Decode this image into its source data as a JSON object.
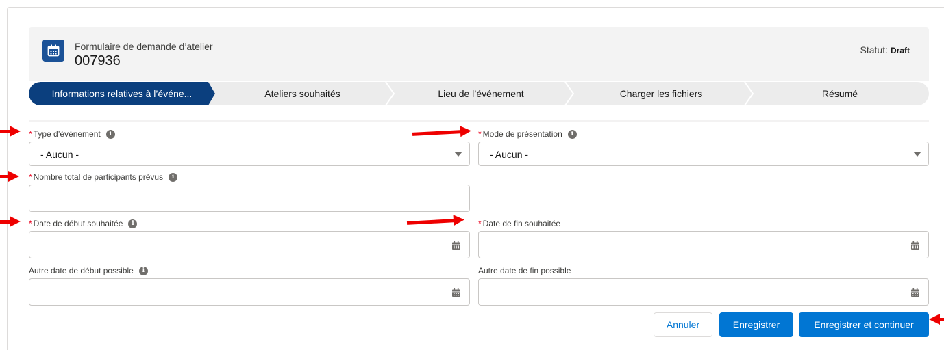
{
  "header": {
    "subtitle": "Formulaire de demande d’atelier",
    "title": "007936",
    "status_label": "Statut:",
    "status_value": "Draft",
    "icon": "calendar-icon",
    "color": "#1b5297"
  },
  "path": {
    "steps": [
      {
        "label": "Informations relatives à l’événe..."
      },
      {
        "label": "Ateliers souhaités"
      },
      {
        "label": "Lieu de l’événement"
      },
      {
        "label": "Charger les fichiers"
      },
      {
        "label": "Résumé"
      }
    ],
    "active_index": 0,
    "active_color": "#0b3f7e"
  },
  "form": {
    "required_marker": "*",
    "info_glyph": "i",
    "type_evenement": {
      "label": "Type d’événement",
      "value": "- Aucun -"
    },
    "mode_presentation": {
      "label": "Mode de présentation",
      "value": "- Aucun -"
    },
    "nombre_participants": {
      "label": "Nombre total de participants prévus",
      "value": ""
    },
    "date_debut": {
      "label": "Date de début souhaitée",
      "value": ""
    },
    "date_fin": {
      "label": "Date de fin souhaitée",
      "value": ""
    },
    "autre_date_debut": {
      "label": "Autre date de début possible",
      "value": ""
    },
    "autre_date_fin": {
      "label": "Autre date de fin possible",
      "value": ""
    }
  },
  "actions": {
    "cancel": "Annuler",
    "save": "Enregistrer",
    "save_continue": "Enregistrer et continuer",
    "brand_color": "#0176d3"
  },
  "annotation_color": "#ee0000"
}
